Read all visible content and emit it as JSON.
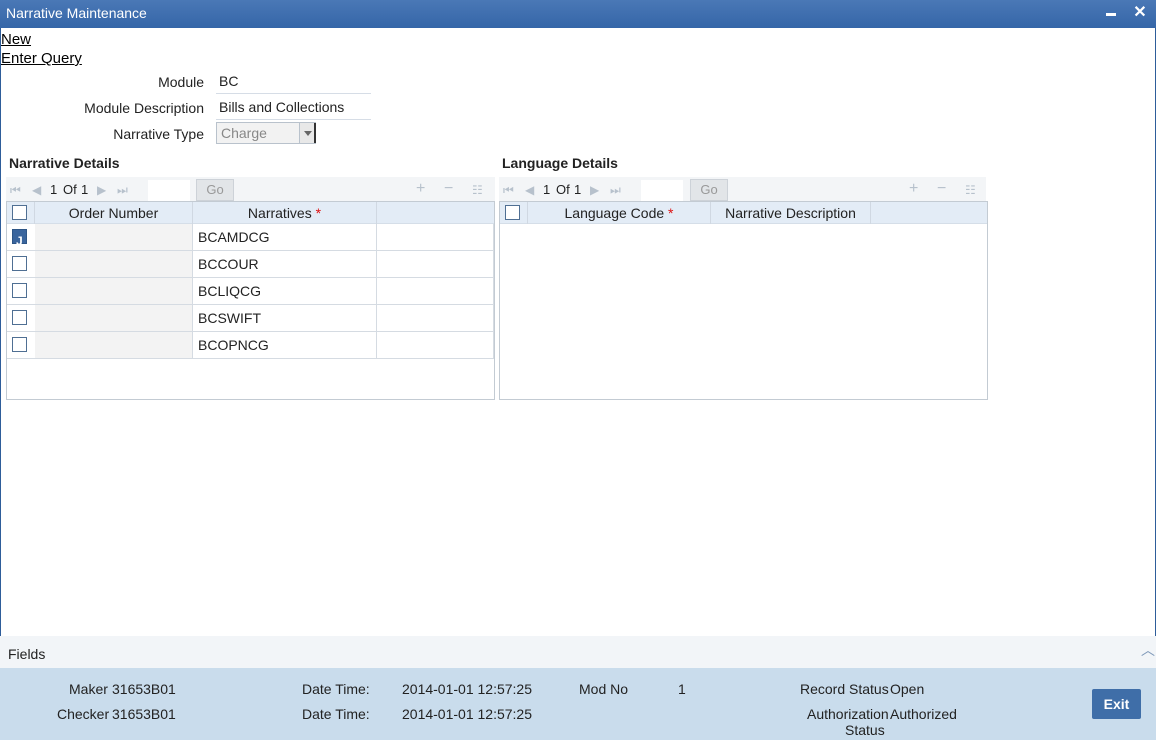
{
  "window": {
    "title": "Narrative Maintenance"
  },
  "actions": {
    "new": "New",
    "enter_query": "Enter Query"
  },
  "form": {
    "module_label": "Module",
    "module_value": "BC",
    "module_desc_label": "Module Description",
    "module_desc_value": "Bills and Collections",
    "narrative_type_label": "Narrative Type",
    "narrative_type_value": "Charge"
  },
  "narrative_details": {
    "title": "Narrative Details",
    "pager": {
      "current": "1",
      "of": "Of",
      "total": "1",
      "go": "Go"
    },
    "columns": [
      "Order Number",
      "Narratives"
    ],
    "rows": [
      {
        "order": "",
        "narrative": "BCAMDCG",
        "checked": true
      },
      {
        "order": "",
        "narrative": "BCCOUR",
        "checked": false
      },
      {
        "order": "",
        "narrative": "BCLIQCG",
        "checked": false
      },
      {
        "order": "",
        "narrative": "BCSWIFT",
        "checked": false
      },
      {
        "order": "",
        "narrative": "BCOPNCG",
        "checked": false
      }
    ]
  },
  "language_details": {
    "title": "Language Details",
    "pager": {
      "current": "1",
      "of": "Of",
      "total": "1",
      "go": "Go"
    },
    "columns": [
      "Language Code",
      "Narrative Description"
    ]
  },
  "fields_bar": {
    "label": "Fields"
  },
  "footer": {
    "maker_label": "Maker",
    "maker_value": "31653B01",
    "checker_label": "Checker",
    "checker_value": "31653B01",
    "dt_label": "Date Time:",
    "maker_dt": "2014-01-01 12:57:25",
    "checker_dt": "2014-01-01 12:57:25",
    "modno_label": "Mod No",
    "modno_value": "1",
    "record_status_label": "Record Status",
    "record_status_value": "Open",
    "auth_status_label_1": "Authorization",
    "auth_status_label_2": "Status",
    "auth_status_value": "Authorized",
    "exit": "Exit"
  }
}
